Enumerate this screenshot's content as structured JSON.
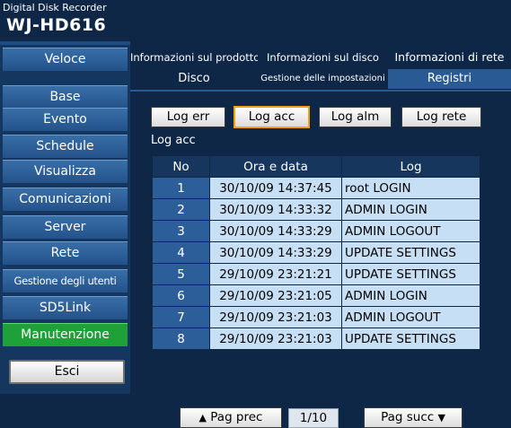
{
  "header": {
    "subtitle": "Digital Disk Recorder",
    "model": "WJ-HD616"
  },
  "sidebar": {
    "items": [
      {
        "label": "Veloce"
      },
      {
        "label": "Base"
      },
      {
        "label": "Evento"
      },
      {
        "label": "Schedule"
      },
      {
        "label": "Visualizza"
      },
      {
        "label": "Comunicazioni"
      },
      {
        "label": "Server"
      },
      {
        "label": "Rete"
      },
      {
        "label": "Gestione degli utenti"
      },
      {
        "label": "SD5Link"
      },
      {
        "label": "Manutenzione"
      }
    ],
    "active": "Manutenzione",
    "exit_label": "Esci"
  },
  "tabs": {
    "row1": [
      "Informazioni sul prodotto",
      "Informazioni sul disco",
      "Informazioni di rete"
    ],
    "row2": [
      "Disco",
      "Gestione delle impostazioni",
      "Registri"
    ],
    "active": "Registri"
  },
  "log_buttons": [
    "Log err",
    "Log acc",
    "Log alm",
    "Log rete"
  ],
  "selected_log": "Log acc",
  "log_title": "Log acc",
  "table": {
    "headers": [
      "No",
      "Ora e data",
      "Log"
    ],
    "rows": [
      {
        "no": "1",
        "datetime": "30/10/09 14:37:45",
        "log": "root LOGIN"
      },
      {
        "no": "2",
        "datetime": "30/10/09 14:33:32",
        "log": "ADMIN LOGIN"
      },
      {
        "no": "3",
        "datetime": "30/10/09 14:33:29",
        "log": "ADMIN LOGOUT"
      },
      {
        "no": "4",
        "datetime": "30/10/09 14:33:29",
        "log": "UPDATE SETTINGS"
      },
      {
        "no": "5",
        "datetime": "29/10/09 23:21:21",
        "log": "UPDATE SETTINGS"
      },
      {
        "no": "6",
        "datetime": "29/10/09 23:21:05",
        "log": "ADMIN LOGIN"
      },
      {
        "no": "7",
        "datetime": "29/10/09 23:21:03",
        "log": "ADMIN LOGOUT"
      },
      {
        "no": "8",
        "datetime": "29/10/09 23:21:03",
        "log": "UPDATE SETTINGS"
      }
    ]
  },
  "pagination": {
    "prev_label": "Pag prec",
    "page": "1/10",
    "next_label": "Pag succ",
    "prev_icon": "triangle-up-icon",
    "next_icon": "triangle-down-icon"
  },
  "colors": {
    "background": "#0f2747",
    "button_blue": "#2e5f98",
    "active_green": "#1fa13a",
    "cell_light": "#c7dff5",
    "selected_outline": "#f2a10a"
  }
}
